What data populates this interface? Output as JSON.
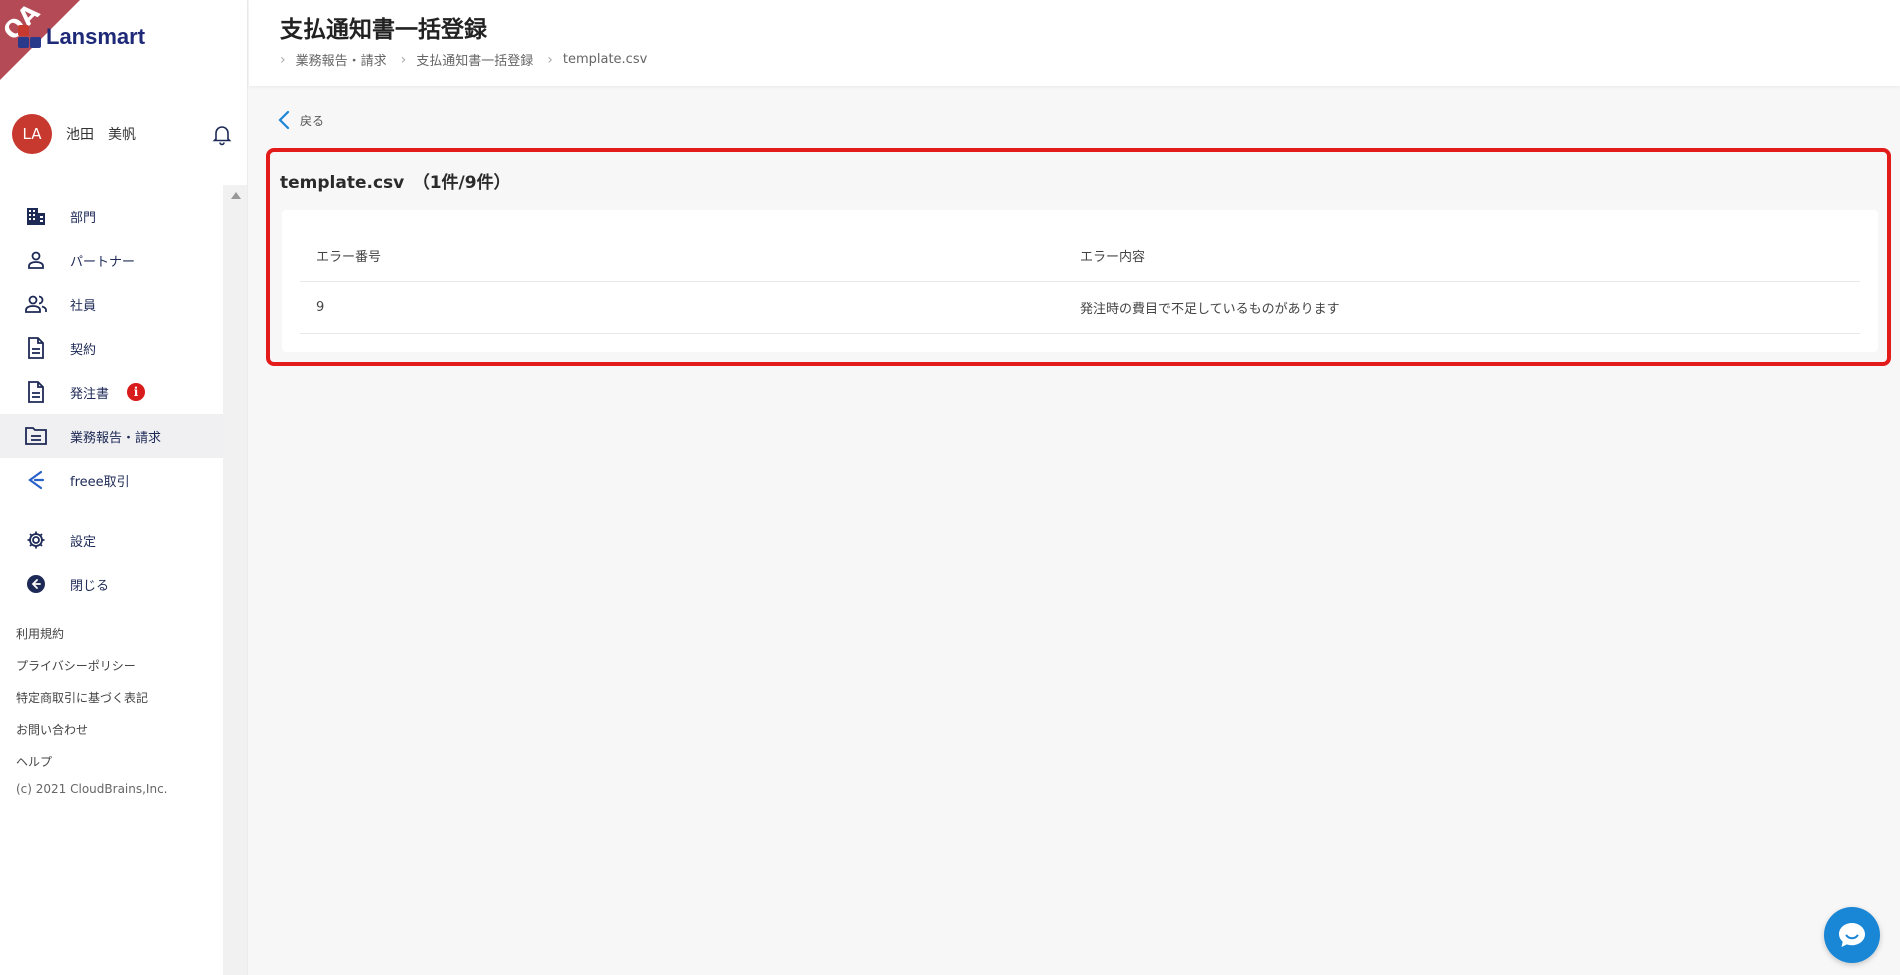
{
  "app": {
    "brand": "Lansmart",
    "qa_badge": "QA"
  },
  "user": {
    "initials": "LA",
    "name": "池田　美帆"
  },
  "sidebar": {
    "items": [
      {
        "label": "部門",
        "icon": "building-icon"
      },
      {
        "label": "パートナー",
        "icon": "person-icon"
      },
      {
        "label": "社員",
        "icon": "people-icon"
      },
      {
        "label": "契約",
        "icon": "document-icon"
      },
      {
        "label": "発注書",
        "icon": "document-icon",
        "badge": "i"
      },
      {
        "label": "業務報告・請求",
        "icon": "folder-list-icon",
        "active": true
      },
      {
        "label": "freee取引",
        "icon": "freee-icon"
      }
    ],
    "settings_label": "設定",
    "close_label": "閉じる",
    "footer_links": [
      "利用規約",
      "プライバシーポリシー",
      "特定商取引に基づく表記",
      "お問い合わせ",
      "ヘルプ"
    ],
    "copyright": "(c) 2021 CloudBrains,Inc."
  },
  "header": {
    "title": "支払通知書一括登録",
    "breadcrumb": [
      "業務報告・請求",
      "支払通知書一括登録",
      "template.csv"
    ]
  },
  "main": {
    "back_label": "戻る",
    "card_title": "template.csv　（1件/9件）",
    "table": {
      "headers": [
        "エラー番号",
        "エラー内容"
      ],
      "rows": [
        {
          "number": "9",
          "message": "発注時の費目で不足しているものがあります"
        }
      ]
    }
  },
  "colors": {
    "brand": "#1e2a78",
    "avatar": "#c7382f",
    "highlight": "#e31b1b",
    "badge": "#d81b1b",
    "chat": "#1a86d6"
  }
}
